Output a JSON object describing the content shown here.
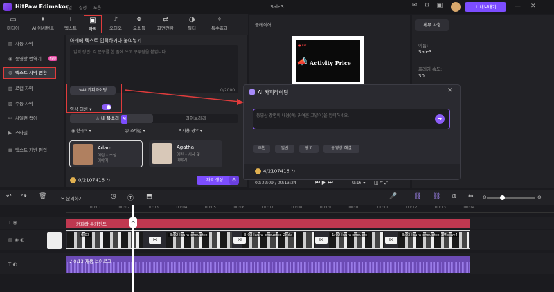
{
  "app": {
    "title": "HitPaw Edimakor",
    "menu": [
      "파일",
      "설정",
      "도움"
    ],
    "project_name": "Sale3",
    "export_label": "내보내기"
  },
  "toolbar": [
    {
      "icon": "media-icon",
      "label": "미디어"
    },
    {
      "icon": "ai-icon",
      "label": "AI 어시턴트"
    },
    {
      "icon": "text-icon",
      "label": "텍스트"
    },
    {
      "icon": "caption-icon",
      "label": "자막"
    },
    {
      "icon": "audio-icon",
      "label": "오디오"
    },
    {
      "icon": "elements-icon",
      "label": "요소들"
    },
    {
      "icon": "transition-icon",
      "label": "화면전환"
    },
    {
      "icon": "filter-icon",
      "label": "필터"
    },
    {
      "icon": "effects-icon",
      "label": "특수효과"
    }
  ],
  "left_nav": [
    {
      "label": "자동 자막"
    },
    {
      "label": "동영상 번역기",
      "badge": "NEW"
    },
    {
      "label": "텍스트 자막 변환"
    },
    {
      "label": "로컬 자막"
    },
    {
      "label": "수동 자막"
    },
    {
      "label": "사일런 컵어"
    },
    {
      "label": "스타일"
    },
    {
      "label": "텍스트 기반 편집"
    }
  ],
  "tts": {
    "hint": "아래에 텍스트 입력하거나 붙여넣기",
    "placeholder": "입력 장면: 각 문구를 한 줄에 쓰고 구두점을 붙입니다.",
    "ai_write_label": "AI 카피라이팅",
    "count": "0/2000",
    "voice_label": "영상 더빙",
    "tab_mine": "내 목소리",
    "tab_ai_badge": "AI",
    "tab_library": "라이브러리",
    "filters": [
      "한국어",
      "스타일",
      "사용 경우"
    ],
    "voices": [
      {
        "name": "Adam",
        "desc1": "어린 • 소설",
        "desc2": "이야기"
      },
      {
        "name": "Agatha",
        "desc1": "어린 • 서사 및",
        "desc2": "이야기"
      }
    ],
    "credits": "0/2107416",
    "generate_label": "자막 생성"
  },
  "player": {
    "header": "플레이어",
    "preview_text": "Activity Price",
    "rec_label": "REC",
    "time_current": "00:02:09",
    "time_total": "00:13:24",
    "ratio": "9:16"
  },
  "props": {
    "tab": "세부 사항",
    "name_label": "이름:",
    "name_value": "Sale3",
    "fps_label": "프레임 속도:",
    "fps_value": "30"
  },
  "dialog": {
    "title": "AI 카피라이팅",
    "placeholder": "동영상 장면의 내용(예: 귀여운 고양이)을 입력하세요.",
    "chips": [
      "추천",
      "일반",
      "광고",
      "동영상 해설"
    ],
    "credits": "4/2107416"
  },
  "timeline": {
    "split_label": "분리하기",
    "ticks": [
      "00:01",
      "00:02",
      "00:03",
      "00:04",
      "00:05",
      "00:06",
      "00:07",
      "00:08",
      "00:09",
      "00:10",
      "00:11",
      "00:12",
      "00:13",
      "00:14"
    ],
    "caption_clip": "커피라 뷰카인드",
    "video_first_time": "0:03",
    "video_segments": [
      "3:02 laura-chouette",
      "3:03 laura-chouette-2hda",
      "1:02 laura-chouett",
      "3:03 laura-chouette-1Mwiav4"
    ],
    "audio_clip": "0:13 재생 브이로그"
  }
}
